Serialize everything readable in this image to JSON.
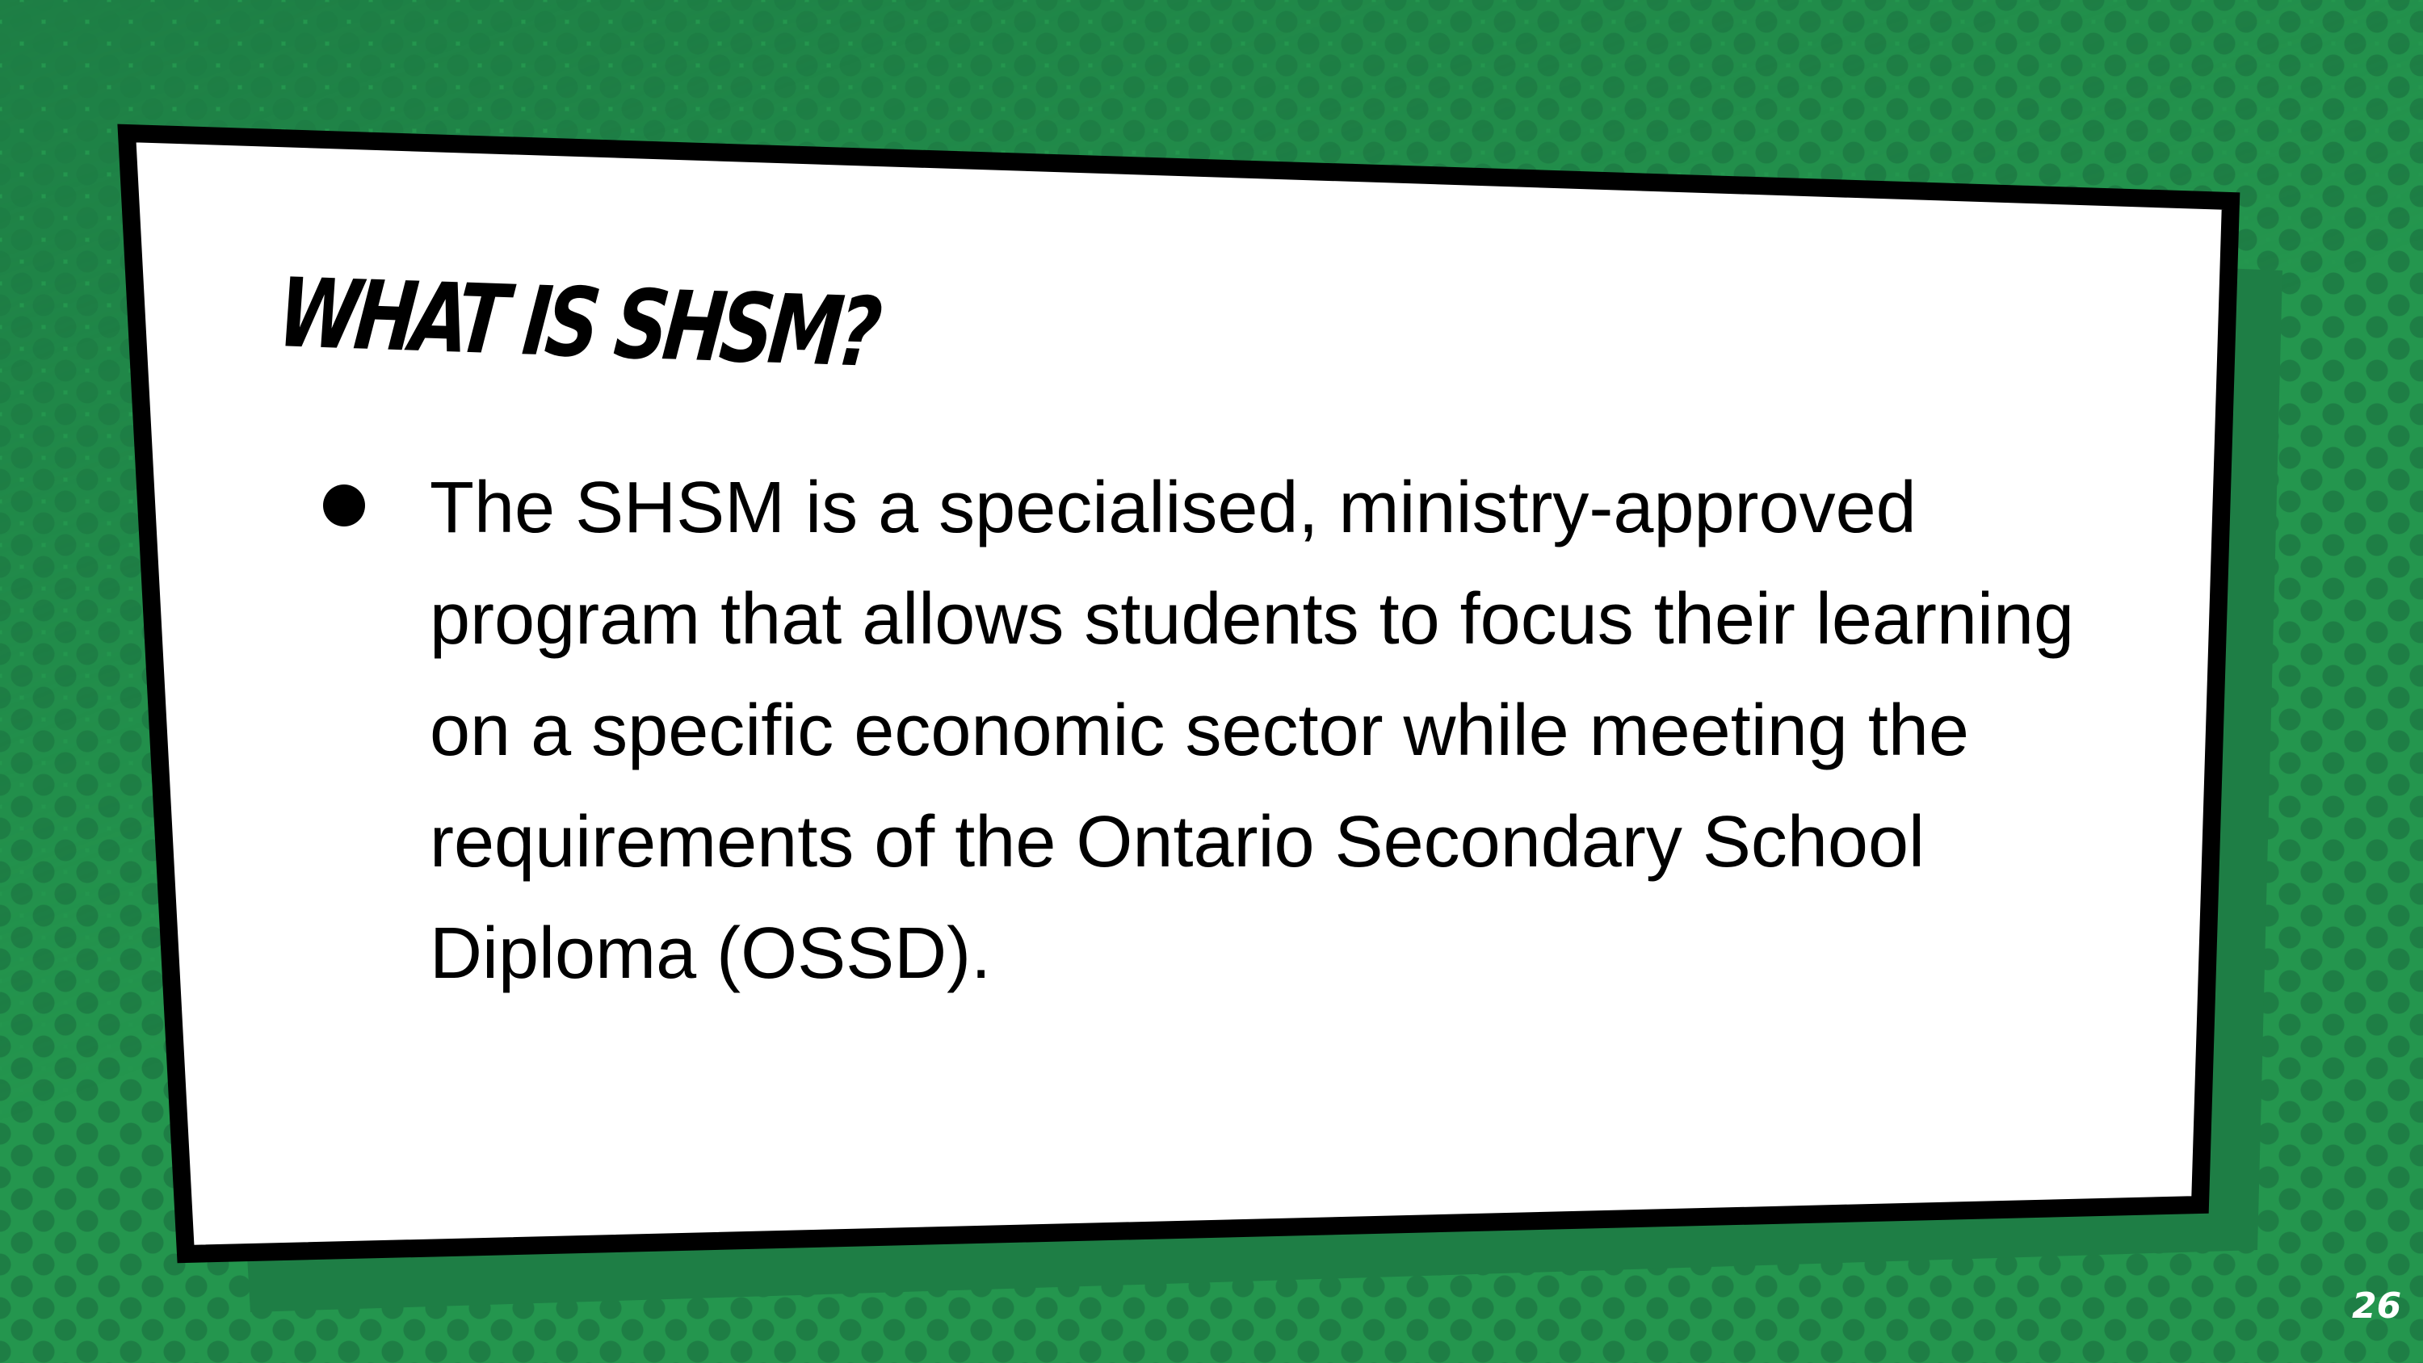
{
  "slide": {
    "title": "What is SHSM?",
    "bullets": [
      "The SHSM is a specialised, ministry-approved program that allows students to focus their learning on a specific economic sector while meeting the requirements of the Ontario Secondary School Diploma (OSSD)."
    ],
    "page_number": "26"
  },
  "colors": {
    "background": "#24964e",
    "dots": "#1e7e45",
    "card": "#ffffff",
    "border": "#000000"
  }
}
